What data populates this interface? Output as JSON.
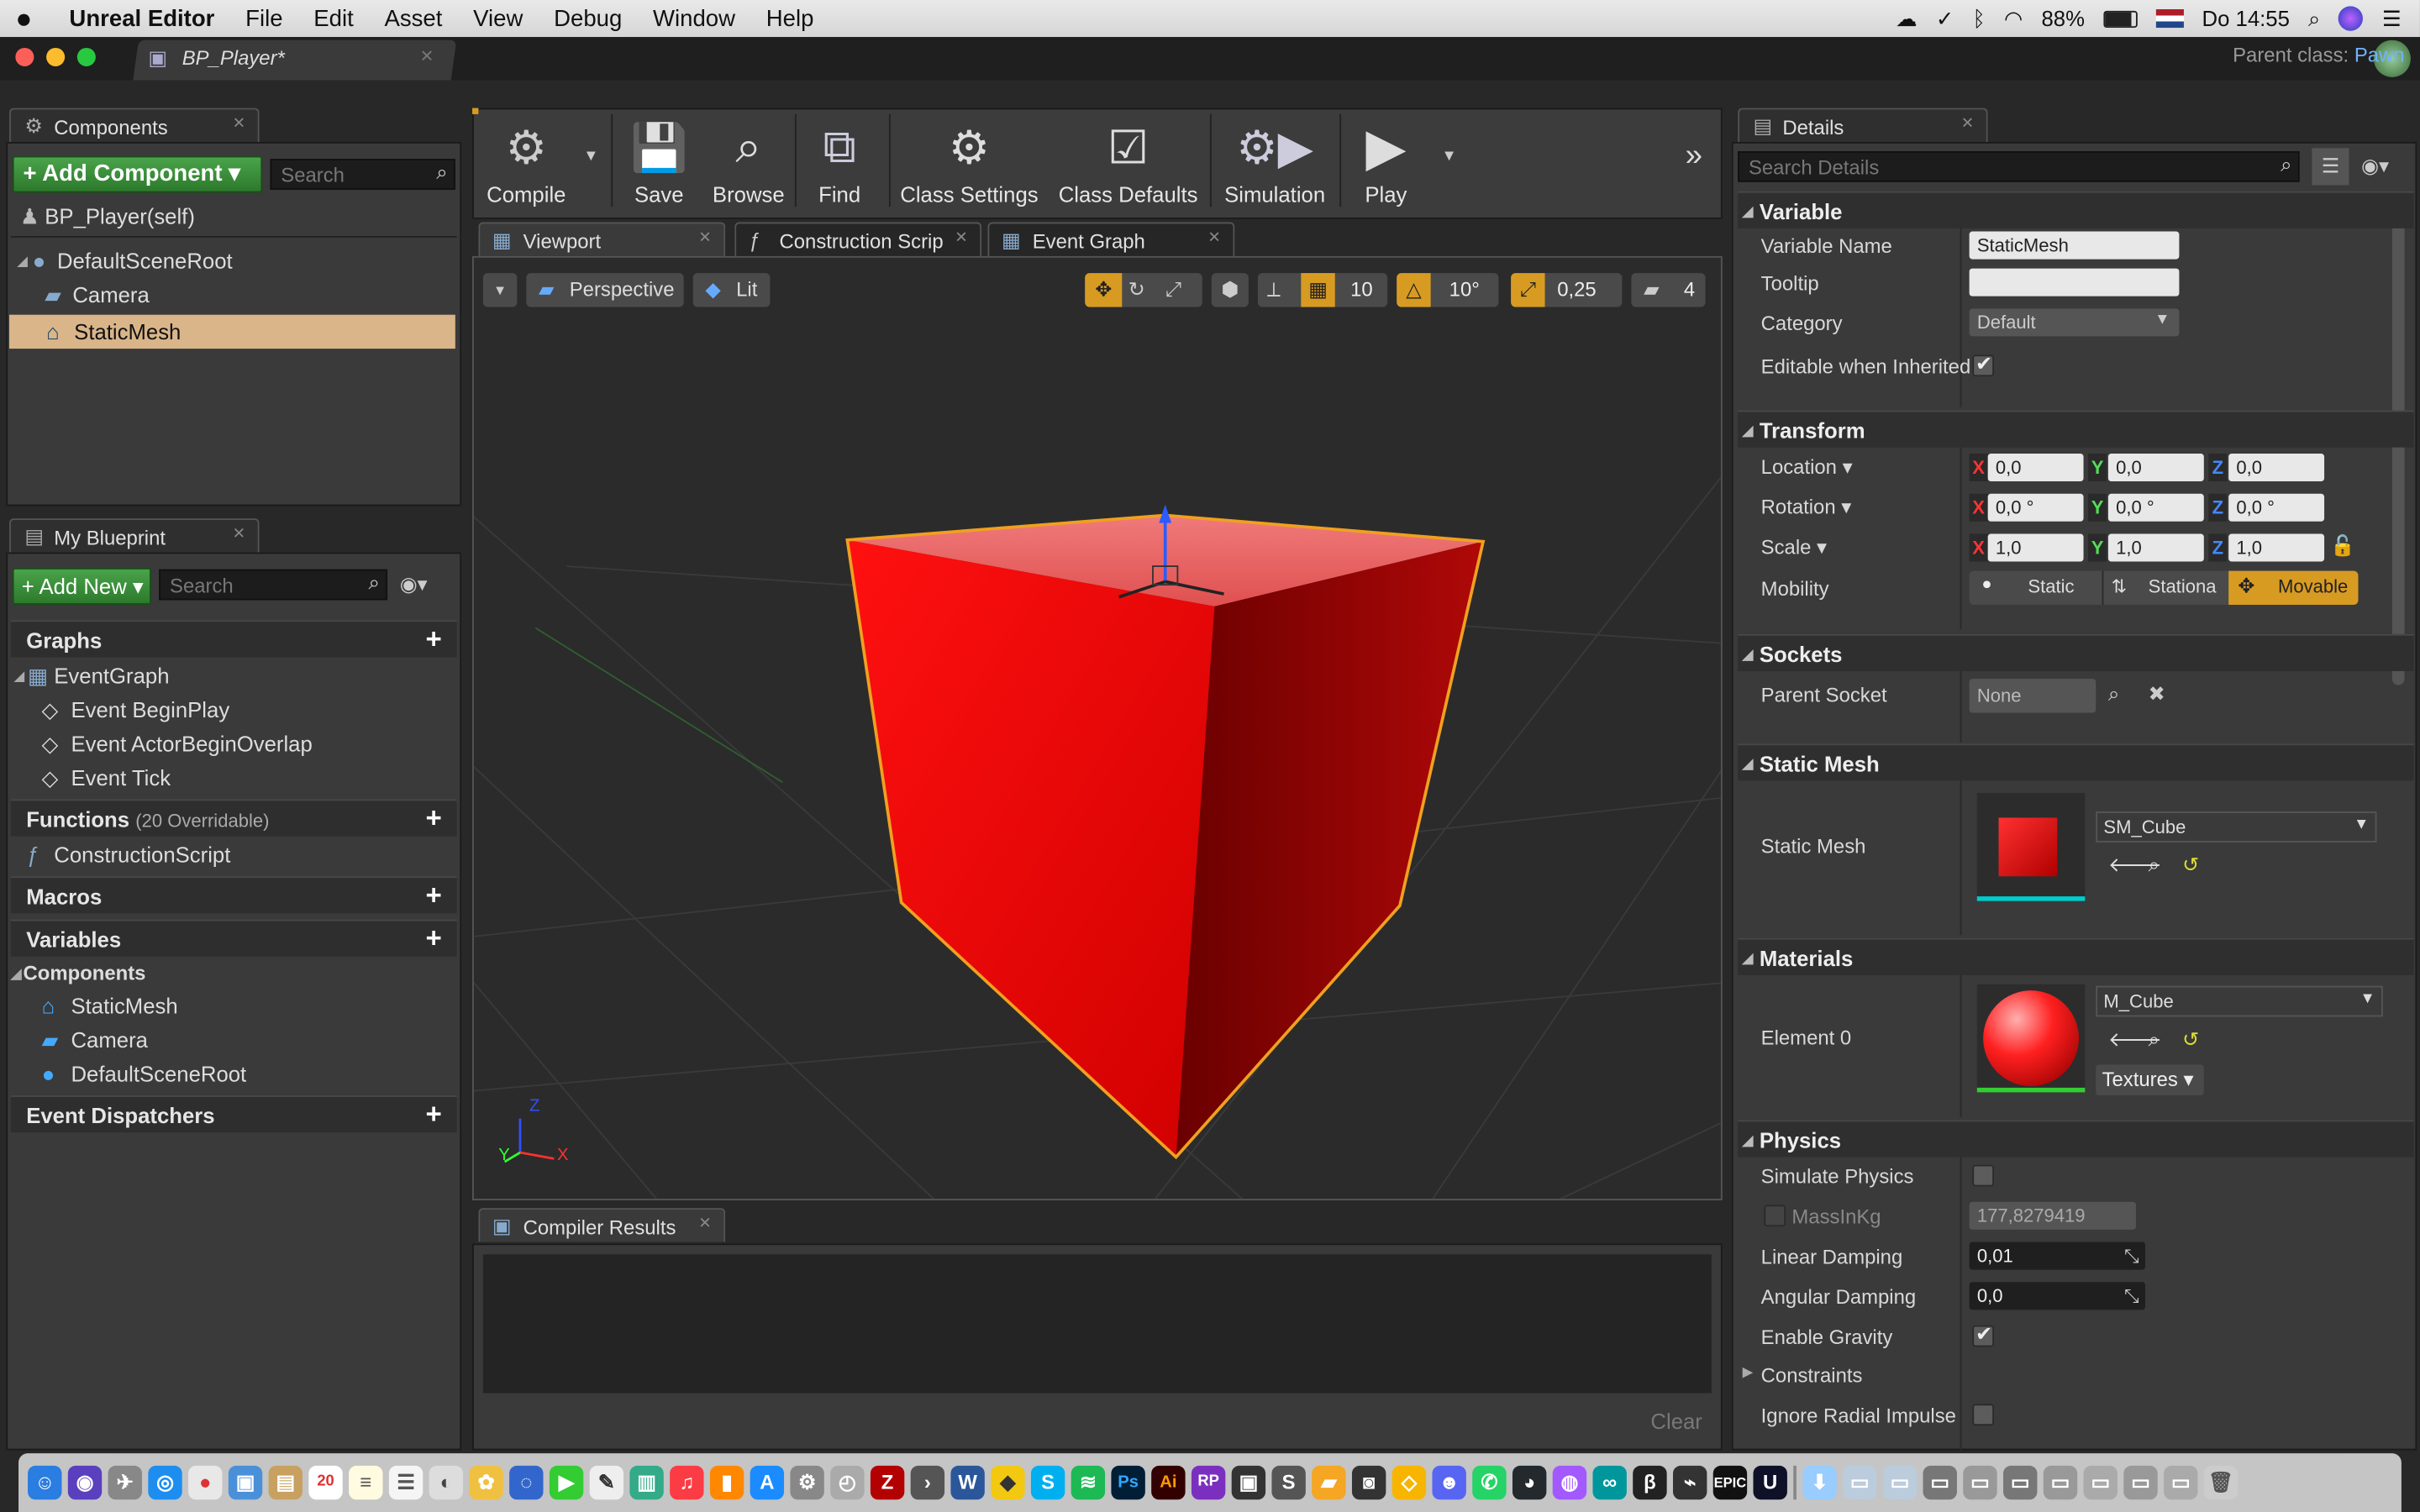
{
  "menubar": {
    "apple": "",
    "app": "Unreal Editor",
    "items": [
      "File",
      "Edit",
      "Asset",
      "View",
      "Debug",
      "Window",
      "Help"
    ],
    "battery": "88%",
    "clock": "Do 14:55"
  },
  "window": {
    "doc_tab": "BP_Player*",
    "parent_class_label": "Parent class:",
    "parent_class": "Pawn"
  },
  "components": {
    "tab": "Components",
    "add_button": "+ Add Component ▾",
    "search_placeholder": "Search",
    "self": "BP_Player(self)",
    "tree": [
      "DefaultSceneRoot",
      "Camera",
      "StaticMesh"
    ]
  },
  "blueprint": {
    "tab": "My Blueprint",
    "add_new": "+ Add New ▾",
    "search_placeholder": "Search",
    "graphs": "Graphs",
    "eventgraph": "EventGraph",
    "events": [
      "Event BeginPlay",
      "Event ActorBeginOverlap",
      "Event Tick"
    ],
    "functions": "Functions",
    "functions_note": "(20 Overridable)",
    "construction": "ConstructionScript",
    "macros": "Macros",
    "variables": "Variables",
    "var_components": "Components",
    "var_items": [
      "StaticMesh",
      "Camera",
      "DefaultSceneRoot"
    ],
    "dispatchers": "Event Dispatchers"
  },
  "toolbar": {
    "compile": "Compile",
    "save": "Save",
    "browse": "Browse",
    "find": "Find",
    "class_settings": "Class Settings",
    "class_defaults": "Class Defaults",
    "simulation": "Simulation",
    "play": "Play"
  },
  "editor_tabs": {
    "viewport": "Viewport",
    "construction": "Construction Scrip",
    "event_graph": "Event Graph"
  },
  "viewport": {
    "perspective": "Perspective",
    "lit": "Lit",
    "grid_snap": "10",
    "rot_snap": "10°",
    "scale_snap": "0,25",
    "cam_speed": "4",
    "axis_z": "Z",
    "axis_y": "Y",
    "axis_x": "X"
  },
  "compiler": {
    "tab": "Compiler Results",
    "clear": "Clear"
  },
  "details": {
    "tab": "Details",
    "search_placeholder": "Search Details",
    "variable": {
      "header": "Variable",
      "name_label": "Variable Name",
      "name": "StaticMesh",
      "tooltip_label": "Tooltip",
      "tooltip": "",
      "category_label": "Category",
      "category": "Default",
      "editable_label": "Editable when Inherited"
    },
    "transform": {
      "header": "Transform",
      "location": "Location ▾",
      "rotation": "Rotation ▾",
      "scale": "Scale ▾",
      "mobility": "Mobility",
      "loc": [
        "0,0",
        "0,0",
        "0,0"
      ],
      "rot": [
        "0,0 °",
        "0,0 °",
        "0,0 °"
      ],
      "scl": [
        "1,0",
        "1,0",
        "1,0"
      ],
      "mob_static": "Static",
      "mob_stationary": "Stationa",
      "mob_movable": "Movable"
    },
    "sockets": {
      "header": "Sockets",
      "parent_label": "Parent Socket",
      "parent": "None"
    },
    "static_mesh": {
      "header": "Static Mesh",
      "label": "Static Mesh",
      "asset": "SM_Cube"
    },
    "materials": {
      "header": "Materials",
      "label": "Element 0",
      "asset": "M_Cube",
      "textures": "Textures ▾"
    },
    "physics": {
      "header": "Physics",
      "simulate": "Simulate Physics",
      "mass_label": "MassInKg",
      "mass": "177,8279419",
      "linear_label": "Linear Damping",
      "linear": "0,01",
      "angular_label": "Angular Damping",
      "angular": "0,0",
      "gravity": "Enable Gravity",
      "constraints": "Constraints",
      "radial": "Ignore Radial Impulse"
    }
  },
  "colors": {
    "accent": "#d89b22",
    "selection": "#d9b589",
    "cube": "#e01010",
    "outline": "#f0a020"
  }
}
